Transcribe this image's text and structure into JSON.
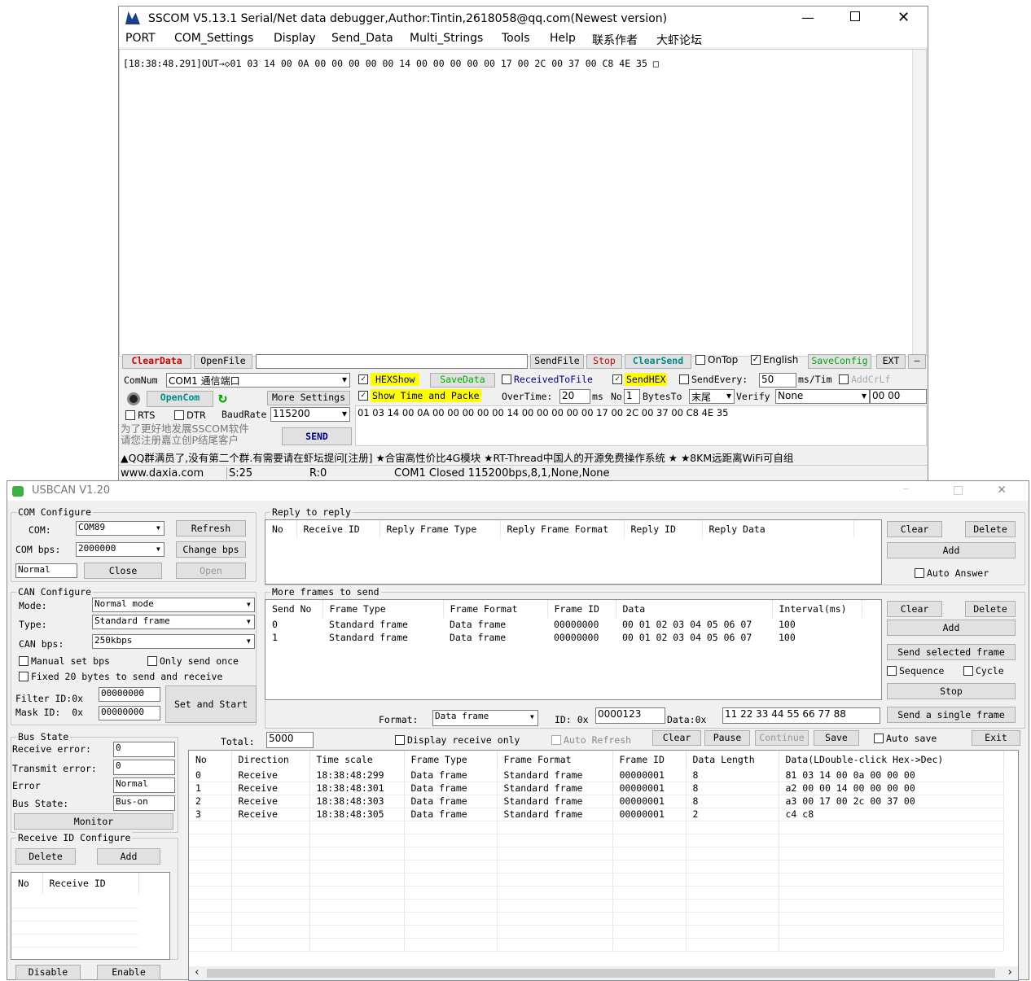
{
  "sscom": {
    "title": "SSCOM V5.13.1 Serial/Net data debugger,Author:Tintin,2618058@qq.com(Newest version)",
    "menu": [
      "PORT",
      "COM_Settings",
      "Display",
      "Send_Data",
      "Multi_Strings",
      "Tools",
      "Help",
      "联系作者",
      "大虾论坛"
    ],
    "log": "[18:38:48.291]OUT→◇01 03 14 00 0A 00 00 00 00 00 14 00 00 00 00 00 17 00 2C 00 37 00 C8 4E 35 □",
    "toolbar": {
      "clear": "ClearData",
      "open_file": "OpenFile",
      "send_file": "SendFile",
      "stop": "Stop",
      "clear_send": "ClearSend",
      "on_top": "OnTop",
      "english": "English",
      "save_config": "SaveConfig",
      "ext": "EXT",
      "minus": "—"
    },
    "comnum_label": "ComNum",
    "comnum_value": "COM1 通信端口",
    "hexshow": "HEXShow",
    "savedata": "SaveData",
    "received_to_file": "ReceivedToFile",
    "sendhex": "SendHEX",
    "send_every": "SendEvery:",
    "send_every_value": "50",
    "ms_tim": "ms/Tim",
    "addcrlf": "AddCrLf",
    "open_com": "OpenCom",
    "more_settings": "More Settings",
    "show_time": "Show Time and Packe",
    "overtime": "OverTime:",
    "overtime_value": "20",
    "ms": "ms",
    "no": "No",
    "no_value": "1",
    "bytes_to": "BytesTo",
    "bytes_to_value": "末尾",
    "verify": "Verify",
    "verify_value": "None",
    "verify_result": "00 00",
    "rts": "RTS",
    "dtr": "DTR",
    "baud_label": "BaudRate",
    "baud_value": "115200",
    "send_data": "01 03 14 00 0A 00 00 00 00 00 14 00 00 00 00 00 17 00 2C 00 37 00 C8 4E 35",
    "promo": "为了更好地发展SSCOM软件\n请您注册嘉立创P结尾客户",
    "send": "SEND",
    "ticker": "▲QQ群满员了,没有第二个群.有需要请在虾坛提问[注册] ★合宙高性价比4G模块 ★RT-Thread中国人的开源免费操作系统 ★ ★8KM远距离WiFi可自组",
    "status": {
      "site": "www.daxia.com",
      "s": "S:25",
      "r": "R:0",
      "port": "COM1 Closed  115200bps,8,1,None,None"
    }
  },
  "usbcan": {
    "title": "USBCAN V1.20",
    "com_config": "COM Configure",
    "com_label": "COM:",
    "com_value": "COM89",
    "refresh": "Refresh",
    "bps_label": "COM bps:",
    "bps_value": "2000000",
    "change_bps": "Change bps",
    "normal_value": "Normal",
    "close": "Close",
    "open": "Open",
    "can_config": "CAN Configure",
    "mode_label": "Mode:",
    "mode_value": "Normal mode",
    "type_label": "Type:",
    "type_value": "Standard frame",
    "canbps_label": "CAN bps:",
    "canbps_value": "250kbps",
    "manual_bps": "Manual set bps",
    "only_once": "Only send once",
    "fixed20": "Fixed 20 bytes to send and receive",
    "filter_label": "Filter ID:0x",
    "filter_value": "00000000",
    "mask_label": "Mask ID:  0x",
    "mask_value": "00000000",
    "set_start": "Set and Start",
    "bus_state": "Bus State",
    "rx_err_label": "Receive error:",
    "rx_err": "0",
    "tx_err_label": "Transmit error:",
    "tx_err": "0",
    "error_label": "Error",
    "error_value": "Normal",
    "bus_label": "Bus State:",
    "bus_value": "Bus-on",
    "monitor": "Monitor",
    "rx_id_cfg": "Receive ID Configure",
    "delete": "Delete",
    "add": "Add",
    "rx_cols": [
      "No",
      "Receive ID"
    ],
    "disable": "Disable",
    "enable": "Enable",
    "reply_group": "Reply to reply",
    "reply_cols": [
      "No",
      "Receive ID",
      "Reply Frame Type",
      "Reply Frame Format",
      "Reply  ID",
      "Reply Data"
    ],
    "clear": "Clear",
    "auto_answer": "Auto Answer",
    "more_group": "More frames to send",
    "send_cols": [
      "Send No",
      "Frame Type",
      "Frame Format",
      "Frame ID",
      "Data",
      "Interval(ms)"
    ],
    "send_rows": [
      [
        "0",
        "Standard frame",
        "Data frame",
        "00000000",
        "00 01 02 03 04 05 06 07",
        "100"
      ],
      [
        "1",
        "Standard frame",
        "Data frame",
        "00000000",
        "00 01 02 03 04 05 06 07",
        "100"
      ]
    ],
    "send_selected": "Send selected frame",
    "sequence": "Sequence",
    "cycle": "Cycle",
    "stop": "Stop",
    "format_label": "Format:",
    "format_value": "Data frame",
    "id_label": "ID: 0x",
    "id_value": "0000123",
    "data_label": "Data:0x",
    "data_value": "11 22 33 44 55 66 77 88",
    "send_single": "Send a single frame",
    "total_label": "Total:",
    "total_value": "5000",
    "display_rx_only": "Display receive only",
    "auto_refresh": "Auto Refresh",
    "pause": "Pause",
    "continue": "Continue",
    "save": "Save",
    "auto_save": "Auto save",
    "exit": "Exit",
    "rx_table_cols": [
      "No",
      "Direction",
      "Time scale",
      "Frame Type",
      "Frame Format",
      "Frame ID",
      "Data Length",
      "Data(LDouble-click Hex->Dec)"
    ],
    "rx_rows": [
      [
        "0",
        "Receive",
        "18:38:48:299",
        "Data frame",
        "Standard frame",
        "00000001",
        "8",
        "81 03 14 00 0a 00 00 00"
      ],
      [
        "1",
        "Receive",
        "18:38:48:301",
        "Data frame",
        "Standard frame",
        "00000001",
        "8",
        "a2 00 00 14 00 00 00 00"
      ],
      [
        "2",
        "Receive",
        "18:38:48:303",
        "Data frame",
        "Standard frame",
        "00000001",
        "8",
        "a3 00 17 00 2c 00 37 00"
      ],
      [
        "3",
        "Receive",
        "18:38:48:305",
        "Data frame",
        "Standard frame",
        "00000001",
        "2",
        "c4 c8"
      ]
    ]
  }
}
